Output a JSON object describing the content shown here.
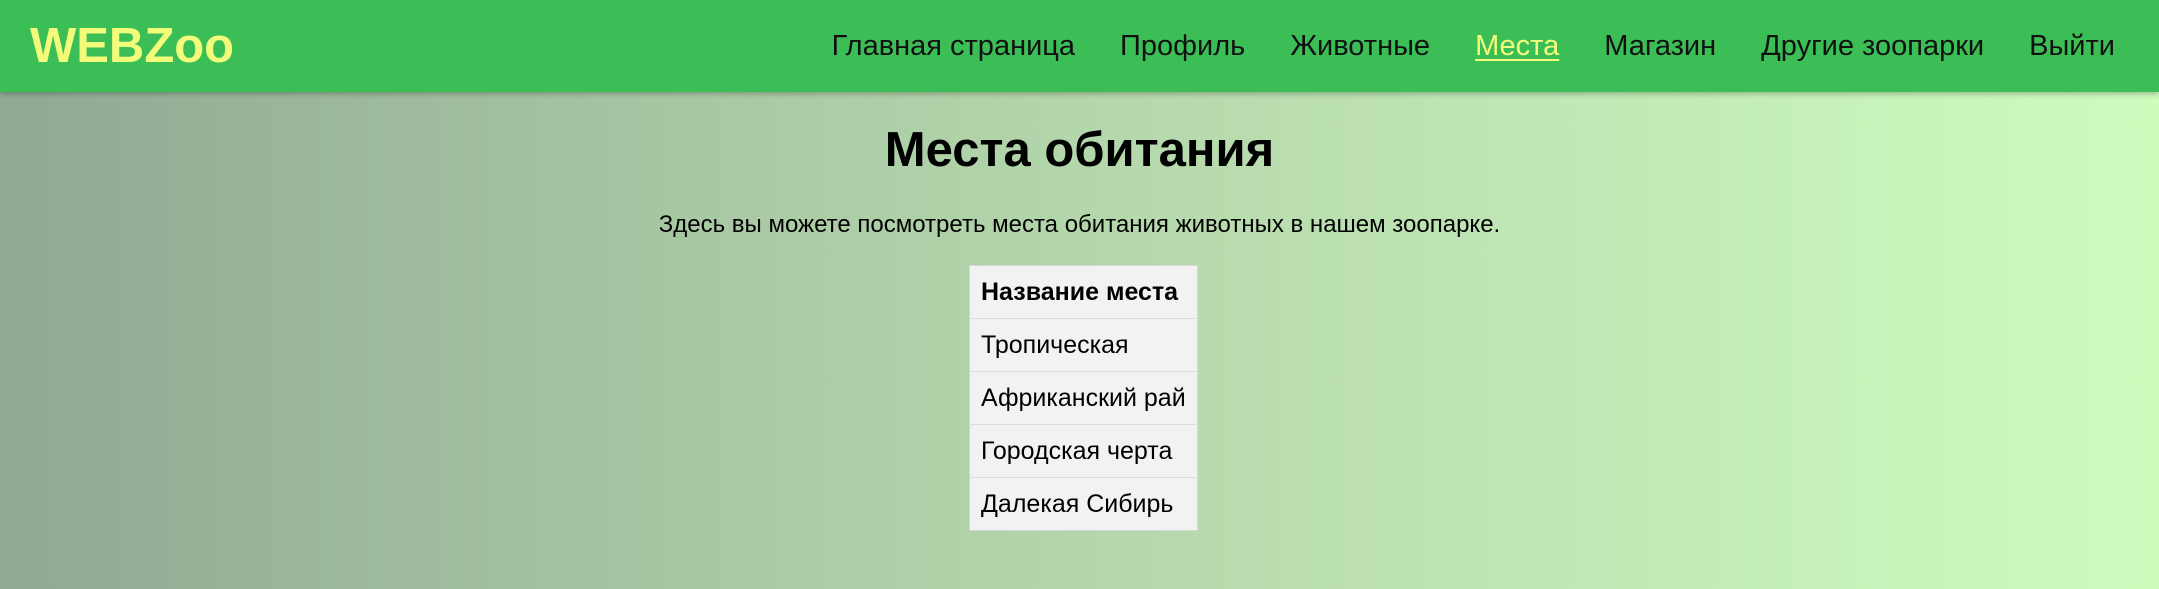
{
  "brand": {
    "name": "WEBZoo"
  },
  "nav": {
    "items": [
      {
        "label": "Главная страница"
      },
      {
        "label": "Профиль"
      },
      {
        "label": "Животные"
      },
      {
        "label": "Места"
      },
      {
        "label": "Магазин"
      },
      {
        "label": "Другие зоопарки"
      },
      {
        "label": "Выйти"
      }
    ],
    "active_label": "Места"
  },
  "main": {
    "title": "Места обитания",
    "intro": "Здесь вы можете посмотреть места обитания животных в нашем зоопарке.",
    "table": {
      "header": "Название места",
      "rows": [
        "Тропическая",
        "Африканский рай",
        "Городская черта",
        "Далекая Сибирь"
      ]
    }
  },
  "colors": {
    "navbar": "#3cbe56",
    "brand": "#f3fb7a",
    "active_link": "#f3fb7a",
    "table_bg": "#f2f2f2"
  }
}
